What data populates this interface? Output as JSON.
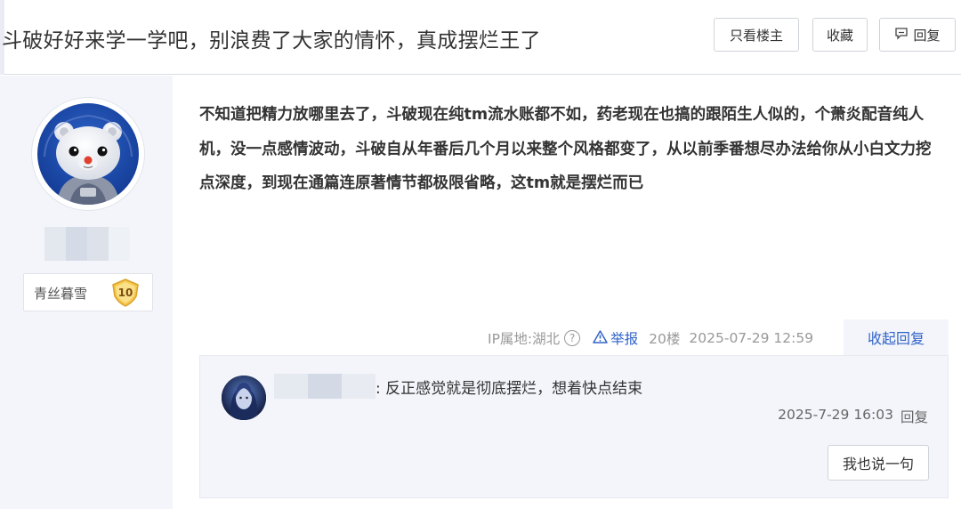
{
  "thread": {
    "title": "斗破好好来学一学吧，别浪费了大家的情怀，真成摆烂王了",
    "buttons": {
      "only_op": "只看楼主",
      "favorite": "收藏",
      "reply": "回复"
    }
  },
  "post": {
    "author_badge": "青丝暮雪",
    "level": "10",
    "content": "不知道把精力放哪里去了，斗破现在纯tm流水账都不如，药老现在也搞的跟陌生人似的，个萧炎配音纯人机，没一点感情波动，斗破自从年番后几个月以来整个风格都变了，从以前季番想尽办法给你从小白文力挖点深度，到现在通篇连原著情节都极限省略，这tm就是摆烂而已",
    "meta": {
      "ip": "IP属地:湖北",
      "help_icon": "?",
      "report": "举报",
      "floor": "20楼",
      "time": "2025-07-29 12:59",
      "collapse": "收起回复"
    }
  },
  "reply": {
    "text": ": 反正感觉就是彻底摆烂，想着快点结束",
    "time": "2025-7-29 16:03",
    "reply_link": "回复",
    "say_button": "我也说一句"
  },
  "colors": {
    "accent_blue": "#3164c8",
    "panel_bg": "#f3f5fa",
    "level_gold": "#f3c04c"
  },
  "icons": {
    "reply": "speech-bubble-icon",
    "help": "question-circle-icon",
    "report": "warning-triangle-icon"
  }
}
